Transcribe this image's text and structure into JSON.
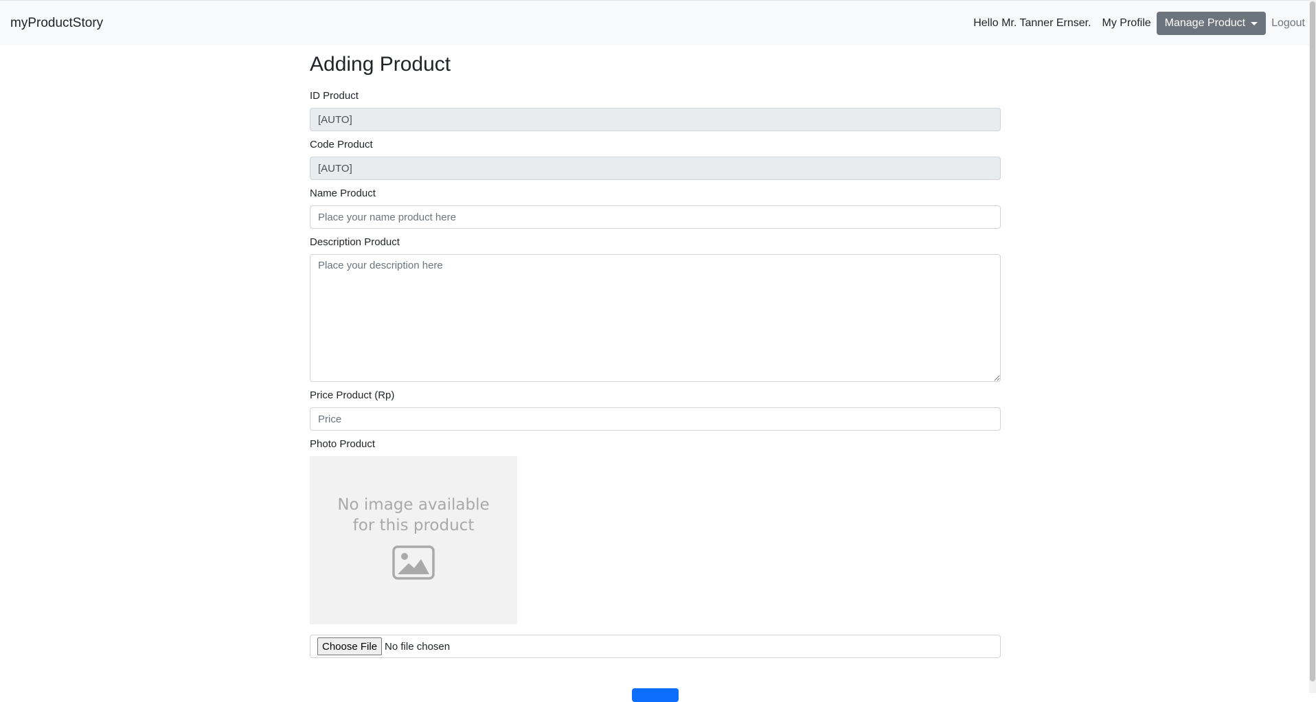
{
  "navbar": {
    "brand": "myProductStory",
    "greeting": "Hello Mr. Tanner Ernser.",
    "profile_link": "My Profile",
    "manage_button": "Manage Product",
    "logout_link": "Logout"
  },
  "form": {
    "title": "Adding Product",
    "id_label": "ID Product",
    "id_value": "[AUTO]",
    "code_label": "Code Product",
    "code_value": "[AUTO]",
    "name_label": "Name Product",
    "name_placeholder": "Place your name product here",
    "description_label": "Description Product",
    "description_placeholder": "Place your description here",
    "price_label": "Price Product (Rp)",
    "price_placeholder": "Price",
    "photo_label": "Photo Product",
    "no_image_text": "No image available for this product",
    "file_button": "Choose File",
    "file_status": "No file chosen"
  },
  "icons": {
    "dropdown": "caret-down-icon",
    "no_image": "image-placeholder-icon"
  },
  "colors": {
    "navbar_bg": "#f8f9fa",
    "manage_button_bg": "#6c757d",
    "submit_button_bg": "#0d6efd"
  }
}
